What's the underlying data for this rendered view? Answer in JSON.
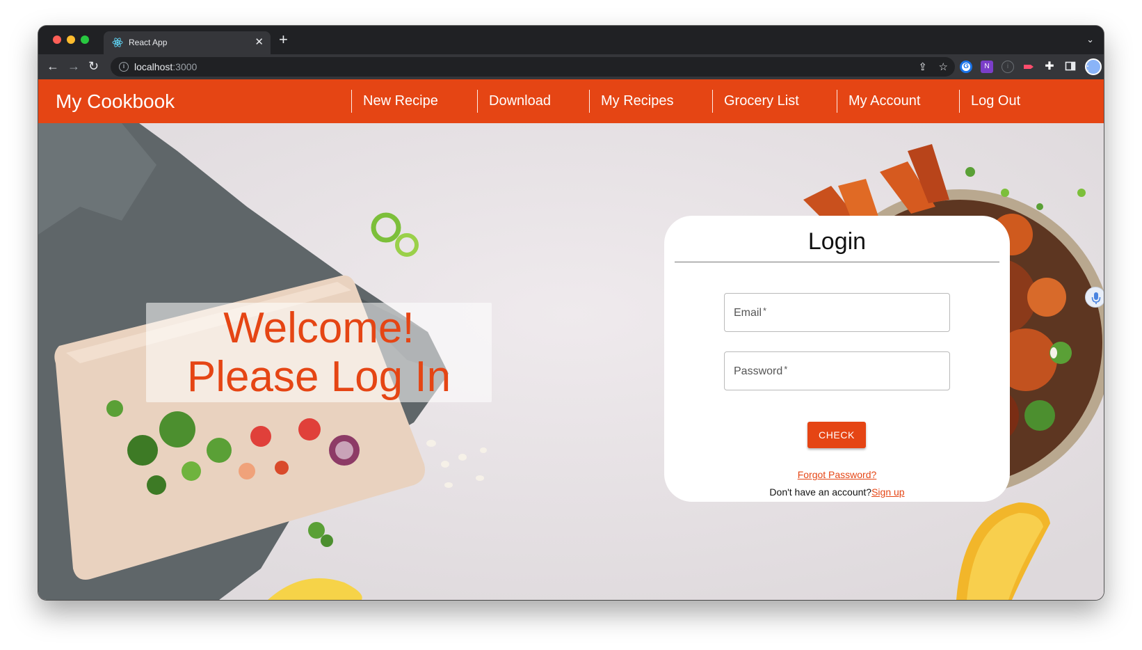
{
  "browser": {
    "tab_title": "React App",
    "tab_close": "✕",
    "new_tab": "+",
    "tab_menu": "⌄",
    "url_host": "localhost",
    "url_port": ":3000",
    "back": "←",
    "forward": "→",
    "reload": "↻",
    "share": "⇪",
    "bookmark": "☆",
    "extensions_icon": "✚",
    "kebab": "⋮"
  },
  "navbar": {
    "brand": "My Cookbook",
    "items": [
      {
        "label": "New Recipe"
      },
      {
        "label": "Download"
      },
      {
        "label": "My Recipes"
      },
      {
        "label": "Grocery List"
      },
      {
        "label": "My Account"
      },
      {
        "label": "Log Out"
      }
    ]
  },
  "welcome": {
    "line1": "Welcome!",
    "line2": "Please Log In"
  },
  "login": {
    "title": "Login",
    "email_label": "Email",
    "password_label": "Password",
    "required_mark": "*",
    "submit_label": "CHECK",
    "forgot_label": "Forgot Password?",
    "no_account_text": "Don't have an account?",
    "signup_label": "Sign up"
  },
  "colors": {
    "accent": "#e54514",
    "browser_dark": "#202124",
    "toolbar": "#35363a"
  }
}
